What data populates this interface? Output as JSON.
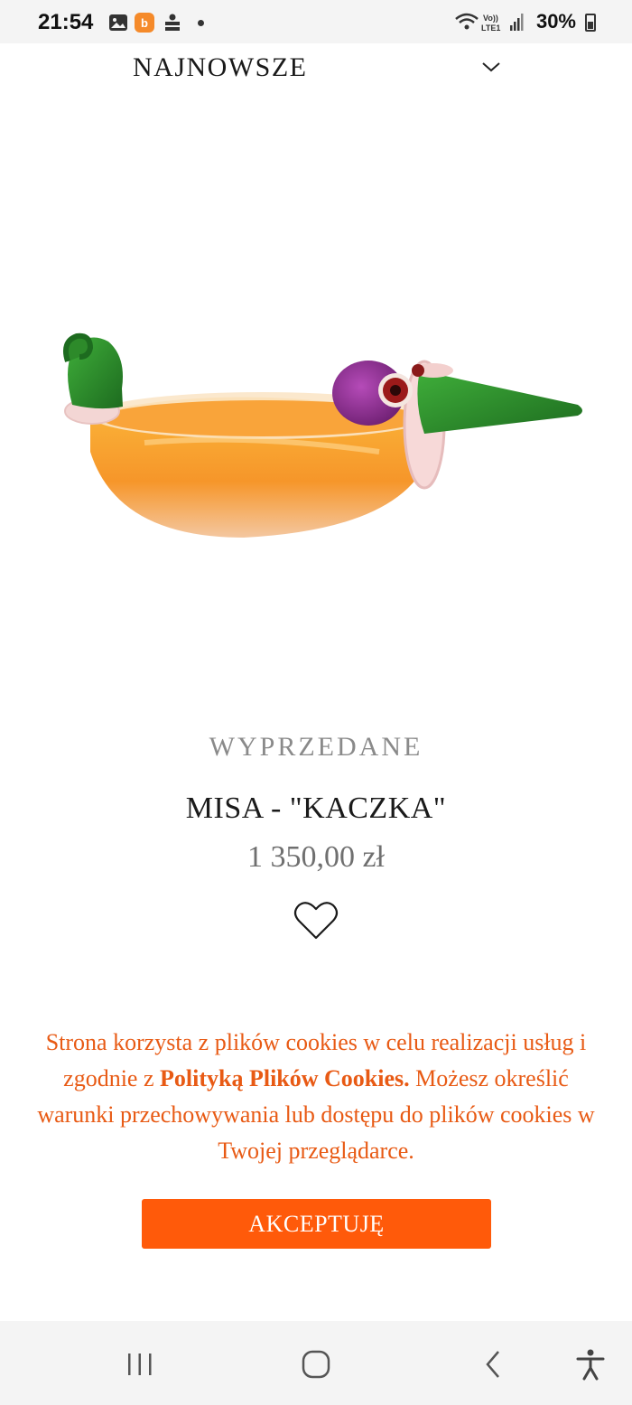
{
  "status_bar": {
    "time": "21:54",
    "battery": "30%",
    "network_label": "Vo) LTE1",
    "icons": [
      "gallery-icon",
      "bubble-app-icon",
      "bank-app-icon",
      "wifi-icon",
      "signal-icon",
      "battery-icon"
    ]
  },
  "sort": {
    "label": "NAJNOWSZE",
    "icon": "chevron-down-icon"
  },
  "product": {
    "status": "WYPRZEDANE",
    "name": "MISA - \"KACZKA\"",
    "price": "1 350,00 zł",
    "wishlist_icon": "heart-outline-icon"
  },
  "cookie_banner": {
    "text_before": "Strona korzysta z plików cookies w celu realizacji usług i zgodnie z ",
    "link_text": "Polityką Plików Cookies.",
    "text_after": " Możesz określić warunki przechowywania lub dostępu do plików cookies w Twojej przeglądarce.",
    "accept_label": "AKCEPTUJĘ"
  },
  "navbar": {
    "buttons": [
      "recent-apps-icon",
      "home-icon",
      "back-icon",
      "accessibility-icon"
    ]
  },
  "colors": {
    "accent": "#ff5a0a",
    "cookie_text": "#e85a14",
    "bowl_orange": "#f7a21e",
    "glass_green": "#2d8a2a",
    "glass_purple": "#8a2a8f"
  }
}
